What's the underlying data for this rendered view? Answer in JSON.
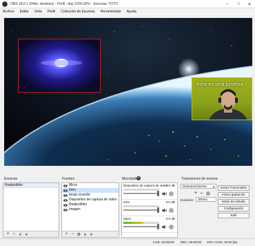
{
  "window": {
    "title": "OBS 18.0.1 (64bit, windows) - Perfil : day CON GPU - Escenas: TOTO",
    "minimize": "–",
    "maximize": "□",
    "close": "✕"
  },
  "menu": [
    "Archivo",
    "Editar",
    "Vista",
    "Perfil",
    "Colección de Escenas",
    "Herramientas",
    "Ayuda"
  ],
  "preview": {
    "webcam_caption": "esta es una prueba"
  },
  "scenes": {
    "label": "Escenas",
    "items": [
      "Realpolitiko"
    ]
  },
  "sources": {
    "label": "Fuentes",
    "items": [
      "Micro",
      "Intro",
      "tengo muerdo",
      "Dispositivo de captura de video",
      "Realpolitiko",
      "Imagen"
    ],
    "selected_index": 1
  },
  "mixer": {
    "label": "Mezclador",
    "tracks": [
      {
        "name": "Dispositivo de captura de video",
        "db": "0.0 dB",
        "meter_level": 0.0,
        "volume": 1.0,
        "muted": true
      },
      {
        "name": "Intro",
        "db": "0.0 dB",
        "meter_level": 0.0,
        "volume": 1.0,
        "muted": true
      },
      {
        "name": "Micro",
        "db": "0.0 dB",
        "meter_level": 0.55,
        "volume": 1.0,
        "muted": false
      }
    ]
  },
  "transitions": {
    "label": "Transiciones de escena",
    "selected": "Desvanecimiento",
    "duration_label": "Duración",
    "duration_value": "300ms"
  },
  "controls": [
    "Iniciar Transmisión",
    "Iniciar grabación",
    "Modo de estudio",
    "Configuración",
    "Salir"
  ],
  "status": {
    "live": "LIVE: 00:00:00",
    "rec": "REC: 00:00:00",
    "cpu": "CPU: 9.0%, 30.00 fps"
  },
  "colors": {
    "selected_row": "#cfe2fb",
    "webcam_bg": "#9fb11f",
    "source_border": "#c01818"
  }
}
